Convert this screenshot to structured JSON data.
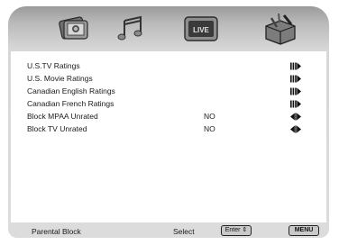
{
  "tabs": [
    {
      "name": "picture-tab",
      "icon": "picture-icon"
    },
    {
      "name": "music-tab",
      "icon": "music-notes-icon"
    },
    {
      "name": "live-tab",
      "icon": "live-tv-icon",
      "label": "LIVE"
    },
    {
      "name": "setup-tab",
      "icon": "toolbox-icon",
      "selected": true
    }
  ],
  "menu": {
    "items": [
      {
        "label": "U.S.TV Ratings",
        "value": "",
        "arrow": "submenu"
      },
      {
        "label": "U.S. Movie Ratings",
        "value": "",
        "arrow": "submenu"
      },
      {
        "label": "Canadian English Ratings",
        "value": "",
        "arrow": "submenu"
      },
      {
        "label": "Canadian French Ratings",
        "value": "",
        "arrow": "submenu"
      },
      {
        "label": "Block MPAA Unrated",
        "value": "NO",
        "arrow": "toggle"
      },
      {
        "label": "Block TV Unrated",
        "value": "NO",
        "arrow": "toggle"
      }
    ]
  },
  "footer": {
    "title": "Parental Block",
    "hint": "Select",
    "enter_key": "Enter",
    "menu_key": "MENU"
  }
}
